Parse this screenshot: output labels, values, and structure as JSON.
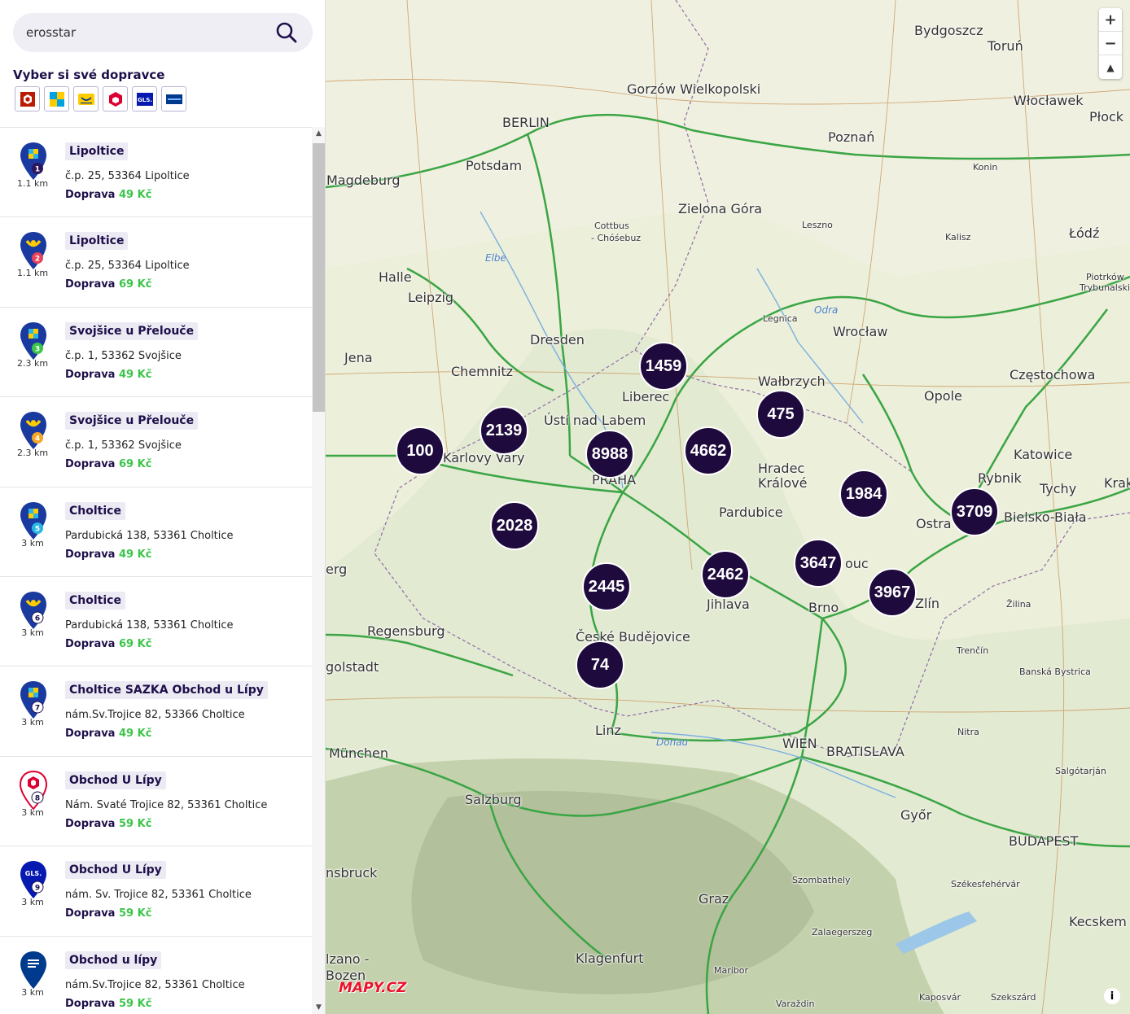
{
  "search": {
    "value": "erosstar"
  },
  "carriers_title": "Vyber si své dopravce",
  "carriers": [
    {
      "name": "zasilkovna",
      "color": "#ba1b02"
    },
    {
      "name": "balikovna",
      "color": "#00a3e0"
    },
    {
      "name": "ceska-posta",
      "color": "#ffcc00"
    },
    {
      "name": "dpd",
      "color": "#dc0032"
    },
    {
      "name": "gls",
      "color": "#061ab1"
    },
    {
      "name": "ppl",
      "color": "#003a8c"
    }
  ],
  "items": [
    {
      "num": "1",
      "dist": "1.1 km",
      "name": "Lipoltice",
      "addr": "č.p. 25, 53364 Lipoltice",
      "price_label": "Doprava",
      "price": "49 Kč",
      "carrier": "balikovna",
      "badge": "#2d1560"
    },
    {
      "num": "2",
      "dist": "1.1 km",
      "name": "Lipoltice",
      "addr": "č.p. 25, 53364 Lipoltice",
      "price_label": "Doprava",
      "price": "69 Kč",
      "carrier": "ceska-posta",
      "badge": "#e8435a"
    },
    {
      "num": "3",
      "dist": "2.3 km",
      "name": "Svojšice u Přelouče",
      "addr": "č.p. 1, 53362 Svojšice",
      "price_label": "Doprava",
      "price": "49 Kč",
      "carrier": "balikovna",
      "badge": "#3cc44a"
    },
    {
      "num": "4",
      "dist": "2.3 km",
      "name": "Svojšice u Přelouče",
      "addr": "č.p. 1, 53362 Svojšice",
      "price_label": "Doprava",
      "price": "69 Kč",
      "carrier": "ceska-posta",
      "badge": "#f5a623"
    },
    {
      "num": "5",
      "dist": "3 km",
      "name": "Choltice",
      "addr": "Pardubická 138, 53361 Choltice",
      "price_label": "Doprava",
      "price": "49 Kč",
      "carrier": "balikovna",
      "badge": "#29b6e6"
    },
    {
      "num": "6",
      "dist": "3 km",
      "name": "Choltice",
      "addr": "Pardubická 138, 53361 Choltice",
      "price_label": "Doprava",
      "price": "69 Kč",
      "carrier": "ceska-posta",
      "badge": "#ffffff"
    },
    {
      "num": "7",
      "dist": "3 km",
      "name": "Choltice SAZKA Obchod u Lípy",
      "addr": "nám.Sv.Trojice 82, 53366 Choltice",
      "price_label": "Doprava",
      "price": "49 Kč",
      "carrier": "balikovna",
      "badge": "#ffffff"
    },
    {
      "num": "8",
      "dist": "3 km",
      "name": "Obchod U Lípy",
      "addr": "Nám. Svaté Trojice 82, 53361 Choltice",
      "price_label": "Doprava",
      "price": "59 Kč",
      "carrier": "dpd",
      "badge": "#ffffff"
    },
    {
      "num": "9",
      "dist": "3 km",
      "name": "Obchod U Lípy",
      "addr": "nám. Sv. Trojice 82, 53361 Choltice",
      "price_label": "Doprava",
      "price": "59 Kč",
      "carrier": "gls",
      "badge": "#ffffff"
    },
    {
      "num": "",
      "dist": "3 km",
      "name": "Obchod u lípy",
      "addr": "nám.Sv.Trojice 82, 53361 Choltice",
      "price_label": "Doprava",
      "price": "59 Kč",
      "carrier": "ppl",
      "badge": ""
    }
  ],
  "map": {
    "logo": "MAPY.CZ",
    "clusters": [
      "1459",
      "475",
      "2139",
      "100",
      "8988",
      "4662",
      "1984",
      "3709",
      "2028",
      "3647",
      "2445",
      "2462",
      "3967",
      "74"
    ],
    "cities": [
      "Bydgoszcz",
      "Toruń",
      "Gorzów Wielkopolski",
      "Włocławek",
      "Płock",
      "BERLIN",
      "Poznań",
      "Potsdam",
      "Magdeburg",
      "Konin",
      "Zielona Góra",
      "Cottbus",
      "- Chóśebuz",
      "Leszno",
      "Kalisz",
      "Łódź",
      "Piotrków",
      "Trybunalski",
      "Halle",
      "Leipzig",
      "Legnica",
      "Wrocław",
      "Dresden",
      "Jena",
      "Chemnitz",
      "Liberec",
      "Wałbrzych",
      "Opole",
      "Częstochowa",
      "Ústí nad Labem",
      "Karlovy Vary",
      "PRAHA",
      "Hradec",
      "Králové",
      "Katowice",
      "Rybnik",
      "Tychy",
      "Krak",
      "Pardubice",
      "Ostra",
      "Bielsko-Biała",
      "erg",
      "ouc",
      "Jihlava",
      "Brno",
      "Zlín",
      "Žilina",
      "Regensburg",
      "České Budějovice",
      "golstadt",
      "Trenčín",
      "Banská Bystrica",
      "Linz",
      "Nitra",
      "München",
      "WIEN",
      "BRATISLAVA",
      "Salgótarján",
      "Salzburg",
      "Győr",
      "BUDAPEST",
      "nsbruck",
      "Szombathely",
      "Székesfehérvár",
      "Graz",
      "Kecskem",
      "Zalaegerszeg",
      "Klagenfurt",
      "lzano -",
      "Bozen",
      "Maribor",
      "Kaposvár",
      "Szekszárd",
      "Varaždin"
    ],
    "rivers": [
      "Elbe",
      "Odra",
      "Donau"
    ]
  }
}
